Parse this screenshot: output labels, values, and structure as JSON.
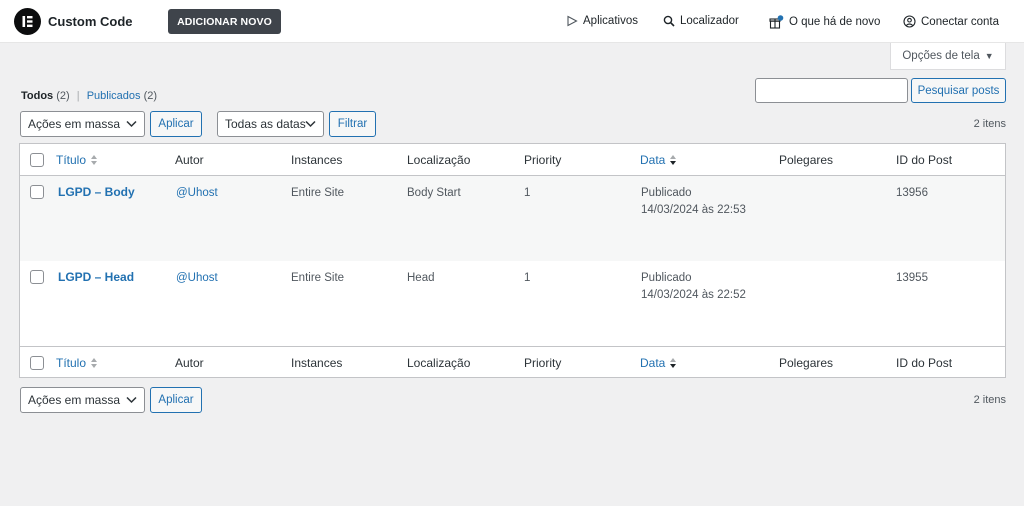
{
  "header": {
    "app_title": "Custom Code",
    "add_new_label": "ADICIONAR NOVO",
    "nav": {
      "apps": "Aplicativos",
      "finder": "Localizador",
      "whats_new": "O que há de novo",
      "connect": "Conectar conta"
    }
  },
  "screen_options": {
    "label": "Opções de tela",
    "arrow": "▼"
  },
  "filters": {
    "all_label": "Todos",
    "all_count": "(2)",
    "separator": "|",
    "published_label": "Publicados",
    "published_count": "(2)"
  },
  "search": {
    "value": "",
    "button_label": "Pesquisar posts"
  },
  "top_nav": {
    "bulk_actions": "Ações em massa",
    "apply": "Aplicar",
    "dates": "Todas as datas",
    "filter": "Filtrar",
    "items_count": "2 itens"
  },
  "bottom_nav": {
    "bulk_actions": "Ações em massa",
    "apply": "Aplicar",
    "items_count": "2 itens"
  },
  "table": {
    "columns": {
      "title": "Título",
      "author": "Autor",
      "instances": "Instances",
      "location": "Localização",
      "priority": "Priority",
      "date": "Data",
      "thumbs": "Polegares",
      "post_id": "ID do Post"
    },
    "rows": [
      {
        "title": "LGPD – Body",
        "author": "@Uhost",
        "instances": "Entire Site",
        "location": "Body Start",
        "priority": "1",
        "date_status": "Publicado",
        "date_value": "14/03/2024 às 22:53",
        "post_id": "13956"
      },
      {
        "title": "LGPD – Head",
        "author": "@Uhost",
        "instances": "Entire Site",
        "location": "Head",
        "priority": "1",
        "date_status": "Publicado",
        "date_value": "14/03/2024 às 22:52",
        "post_id": "13955"
      }
    ]
  },
  "colors": {
    "accent": "#2271b1",
    "page_bg": "#f0f0f1",
    "dark_button": "#3f444b",
    "notification_dot": "#2271b1"
  }
}
